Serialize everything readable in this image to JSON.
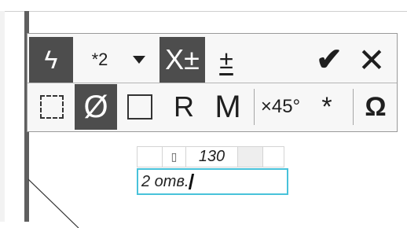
{
  "toolbar": {
    "row1": {
      "lightning_icon": "lightning-icon",
      "star_selector_label": "*2",
      "dropdown_icon": "triangle-down-icon",
      "x_tolerance_label": "X±",
      "plus_minus_label": "±",
      "confirm_icon": "check-icon",
      "cancel_icon": "cross-icon"
    },
    "row2": {
      "dashed_rect_icon": "dashed-rectangle-icon",
      "diameter_label": "Ø",
      "square_icon": "square-icon",
      "radius_label": "R",
      "m_label": "M",
      "chamfer_label": "×45°",
      "star_label": "*",
      "omega_label": "Ω"
    }
  },
  "dimension_editor": {
    "symbol_placeholder": "▯",
    "value": "130",
    "input_text": "2 отв."
  },
  "colors": {
    "active_button_bg": "#4d4d4d",
    "confirm": "#2aa32a",
    "cancel": "#e31b1b",
    "input_border": "#48c2da"
  }
}
